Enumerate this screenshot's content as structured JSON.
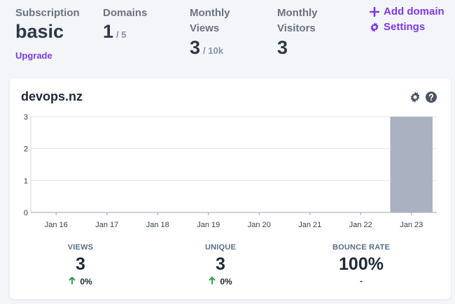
{
  "stats": {
    "subscription": {
      "label": "Subscription",
      "value": "basic",
      "action": "Upgrade"
    },
    "domains": {
      "label": "Domains",
      "value": "1",
      "limit": "/ 5"
    },
    "monthly_views": {
      "label_line1": "Monthly",
      "label_line2": "Views",
      "value": "3",
      "limit": "/ 10k"
    },
    "monthly_visitors": {
      "label_line1": "Monthly",
      "label_line2": "Visitors",
      "value": "3"
    }
  },
  "actions": {
    "add_domain": "Add domain",
    "settings": "Settings"
  },
  "colors": {
    "accent": "#7c3aed",
    "bar": "#aab2c2",
    "up_arrow": "#2f9e44"
  },
  "card": {
    "domain": "devops.nz",
    "icons": [
      "gear-icon",
      "question-icon"
    ],
    "metrics": [
      {
        "label": "VIEWS",
        "value": "3",
        "change": "0%",
        "trend_icon": "arrow-up-icon"
      },
      {
        "label": "UNIQUE",
        "value": "3",
        "change": "0%",
        "trend_icon": "arrow-up-icon"
      },
      {
        "label": "BOUNCE RATE",
        "value": "100%",
        "change": "-",
        "trend_icon": ""
      }
    ]
  },
  "chart_data": {
    "type": "bar",
    "categories": [
      "Jan 16",
      "Jan 17",
      "Jan 18",
      "Jan 19",
      "Jan 20",
      "Jan 21",
      "Jan 22",
      "Jan 23"
    ],
    "values": [
      0,
      0,
      0,
      0,
      0,
      0,
      0,
      3
    ],
    "ylim": [
      0,
      3
    ],
    "yticks": [
      "0",
      "1",
      "2",
      "3"
    ],
    "grid": true,
    "title": "",
    "xlabel": "",
    "ylabel": ""
  }
}
